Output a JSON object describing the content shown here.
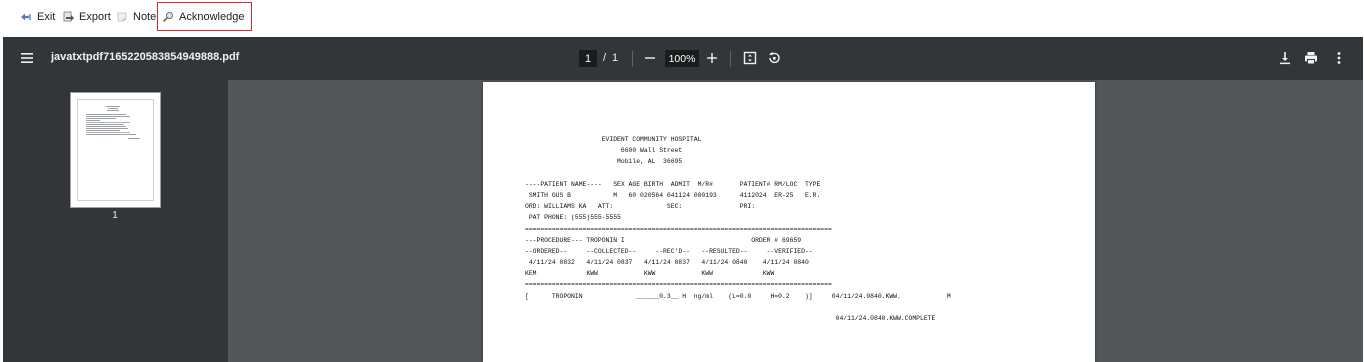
{
  "toolbar": {
    "exit_label": "Exit",
    "export_label": "Export",
    "note_label": "Note",
    "acknowledge_label": "Acknowledge",
    "highlight_color": "#d9282f"
  },
  "viewer": {
    "file_name": "javatxtpdf7165220583854949888.pdf",
    "current_page": "1",
    "page_separator": "/",
    "total_pages": "1",
    "zoom": "100%",
    "thumbnail_label": "1",
    "bar_color": "#323639",
    "background_color": "#525659"
  },
  "document": {
    "lines": [
      "                    EVIDENT COMMUNITY HOSPITAL",
      "                         6600 Wall Street",
      "                        Mobile, AL  36695",
      "",
      "----PATIENT NAME----   SEX AGE BIRTH  ADMIT  M/R#       PATIENT# RM/LOC  TYPE",
      " SMITH GUS B           M   60 020564 041124 000193      4112024  ER-25   E.R.",
      "ORD: WILLIAMS KA   ATT:              SEC:               PRI:",
      " PAT PHONE: (555)555-5555",
      "================================================================================",
      "---PROCEDURE--- TROPONIN I                                 ORDER # 69659",
      "--ORDERED--     --COLLECTED--     --REC'D--   --RESULTED--     --VERIFIED--",
      " 4/11/24 0832   4/11/24 0837   4/11/24 0837   4/11/24 0840    4/11/24 0840",
      "KEM             KWW            KWW            KWW             KWW",
      "================================================================================",
      "[      TROPONIN              ______0.3__ H  ng/ml    (L=0.0     H=0.2    )]     04/11/24.0840.KWW.            M",
      "",
      "                                                                                 04/11/24.0840.KWW.COMPLETE"
    ]
  }
}
